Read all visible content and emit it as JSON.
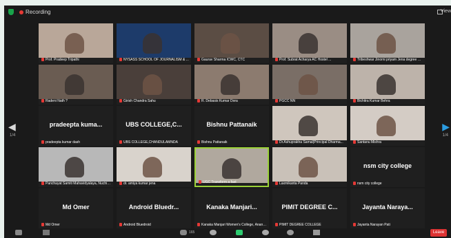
{
  "header": {
    "recording_label": "Recording",
    "view_label": "View"
  },
  "nav": {
    "page_left": "1/4",
    "page_right": "1/4"
  },
  "participants": [
    {
      "name": "Prof. Pradeep Tripathi",
      "display": ""
    },
    {
      "name": "NYSASS SCHOOL OF JOURNALISM & ...",
      "display": ""
    },
    {
      "name": "Gaurav Sharma ICWC, CTC",
      "display": ""
    },
    {
      "name": "Prof. Subrat Acharya AC Hostel ...",
      "display": ""
    },
    {
      "name": "Tribeshwar Jinorni priyam Jena degree Col...",
      "display": ""
    },
    {
      "name": "Radeni Nath ?",
      "display": ""
    },
    {
      "name": "Girish Chandra Sahu",
      "display": ""
    },
    {
      "name": "R. Debasis Kumar Dora",
      "display": ""
    },
    {
      "name": "PGCC NN",
      "display": ""
    },
    {
      "name": "Bichitra Kumar Behra",
      "display": ""
    },
    {
      "name": "pradeepta kumar dash",
      "display": "pradeepta kuma..."
    },
    {
      "name": "UBS COLLEGE,CHANDULAMNDA",
      "display": "UBS COLLEGE,C..."
    },
    {
      "name": "Bishnu Pattanaik",
      "display": "Bishnu Pattanaik"
    },
    {
      "name": "Dr.Ashuprakha Samal(Principal Dharma...",
      "display": ""
    },
    {
      "name": "Santanu Mishra",
      "display": ""
    },
    {
      "name": "Panchayat Samiti Mahavidyalaya, Nuchintak...",
      "display": ""
    },
    {
      "name": "dr. amiya kumar jena",
      "display": ""
    },
    {
      "name": "UGC Transform a fast",
      "display": ""
    },
    {
      "name": "Laxmikanta Panda",
      "display": ""
    },
    {
      "name": "nsm city college",
      "display": "nsm city college"
    },
    {
      "name": "Md Omer",
      "display": "Md Omer"
    },
    {
      "name": "Android Bluedroid",
      "display": "Android Bluedr..."
    },
    {
      "name": "Kanaka Manjari Women's College, Anana...",
      "display": "Kanaka Manjari..."
    },
    {
      "name": "PIMIT DEGREE COLLEGE",
      "display": "PIMIT DEGREE C..."
    },
    {
      "name": "Jayanta Narayan Pati",
      "display": "Jayanta Naraya..."
    }
  ],
  "footer": {
    "leave_label": "Leave",
    "participants_count": "165"
  }
}
